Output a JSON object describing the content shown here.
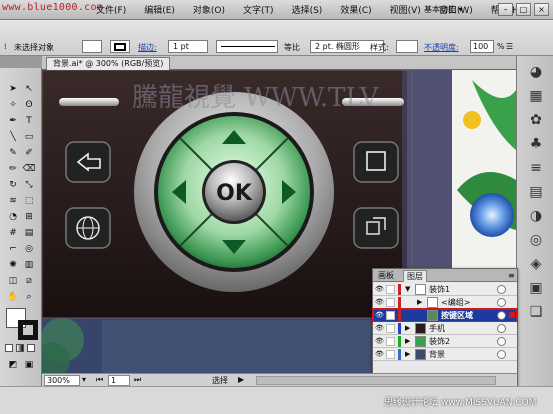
{
  "watermark_top": "www.blue1000.com",
  "watermark_canvas": "騰龍視覺 WWW.TLV",
  "watermark_bottom": "思缘设计论坛 www.MISSVUAN.COM",
  "menu": [
    "文件(F)",
    "编辑(E)",
    "对象(O)",
    "文字(T)",
    "选择(S)",
    "效果(C)",
    "视图(V)",
    "窗口(W)",
    "帮助(H)"
  ],
  "workspace": "基本功能 ▾",
  "window_buttons": [
    "–",
    "□",
    "×"
  ],
  "control_bar": {
    "selection_label": "未选择对象",
    "stroke_label": "描边:",
    "stroke_weight": "1 pt",
    "profile_label": "等比",
    "brush_label": "2 pt. 椭圆形",
    "style_label": "样式:",
    "opacity_label": "不透明度:",
    "opacity_value": "100",
    "opacity_unit": "%"
  },
  "document_tab": "背景.ai* @ 300% (RGB/预览)",
  "device": {
    "ok_label": "OK",
    "accent_color": "#1c7a3c",
    "body_color": "#2a1c1c"
  },
  "layers_panel": {
    "tabs": [
      "画板",
      "图层"
    ],
    "rows": [
      {
        "name": "装饰1",
        "indent": 0,
        "bar": "#cc2222",
        "expanded": true
      },
      {
        "name": "<编组>",
        "indent": 1,
        "bar": "#cc2222",
        "expanded": false
      },
      {
        "name": "按键区域",
        "indent": 1,
        "bar": "#cc2222",
        "selected": true
      },
      {
        "name": "手机",
        "indent": 0,
        "bar": "#2244cc",
        "expanded": false
      },
      {
        "name": "装饰2",
        "indent": 0,
        "bar": "#22aa22",
        "expanded": false
      },
      {
        "name": "背景",
        "indent": 0,
        "bar": "#4466cc",
        "expanded": false
      }
    ]
  },
  "status": {
    "zoom": "300%",
    "page": "1",
    "mode": "选择"
  }
}
